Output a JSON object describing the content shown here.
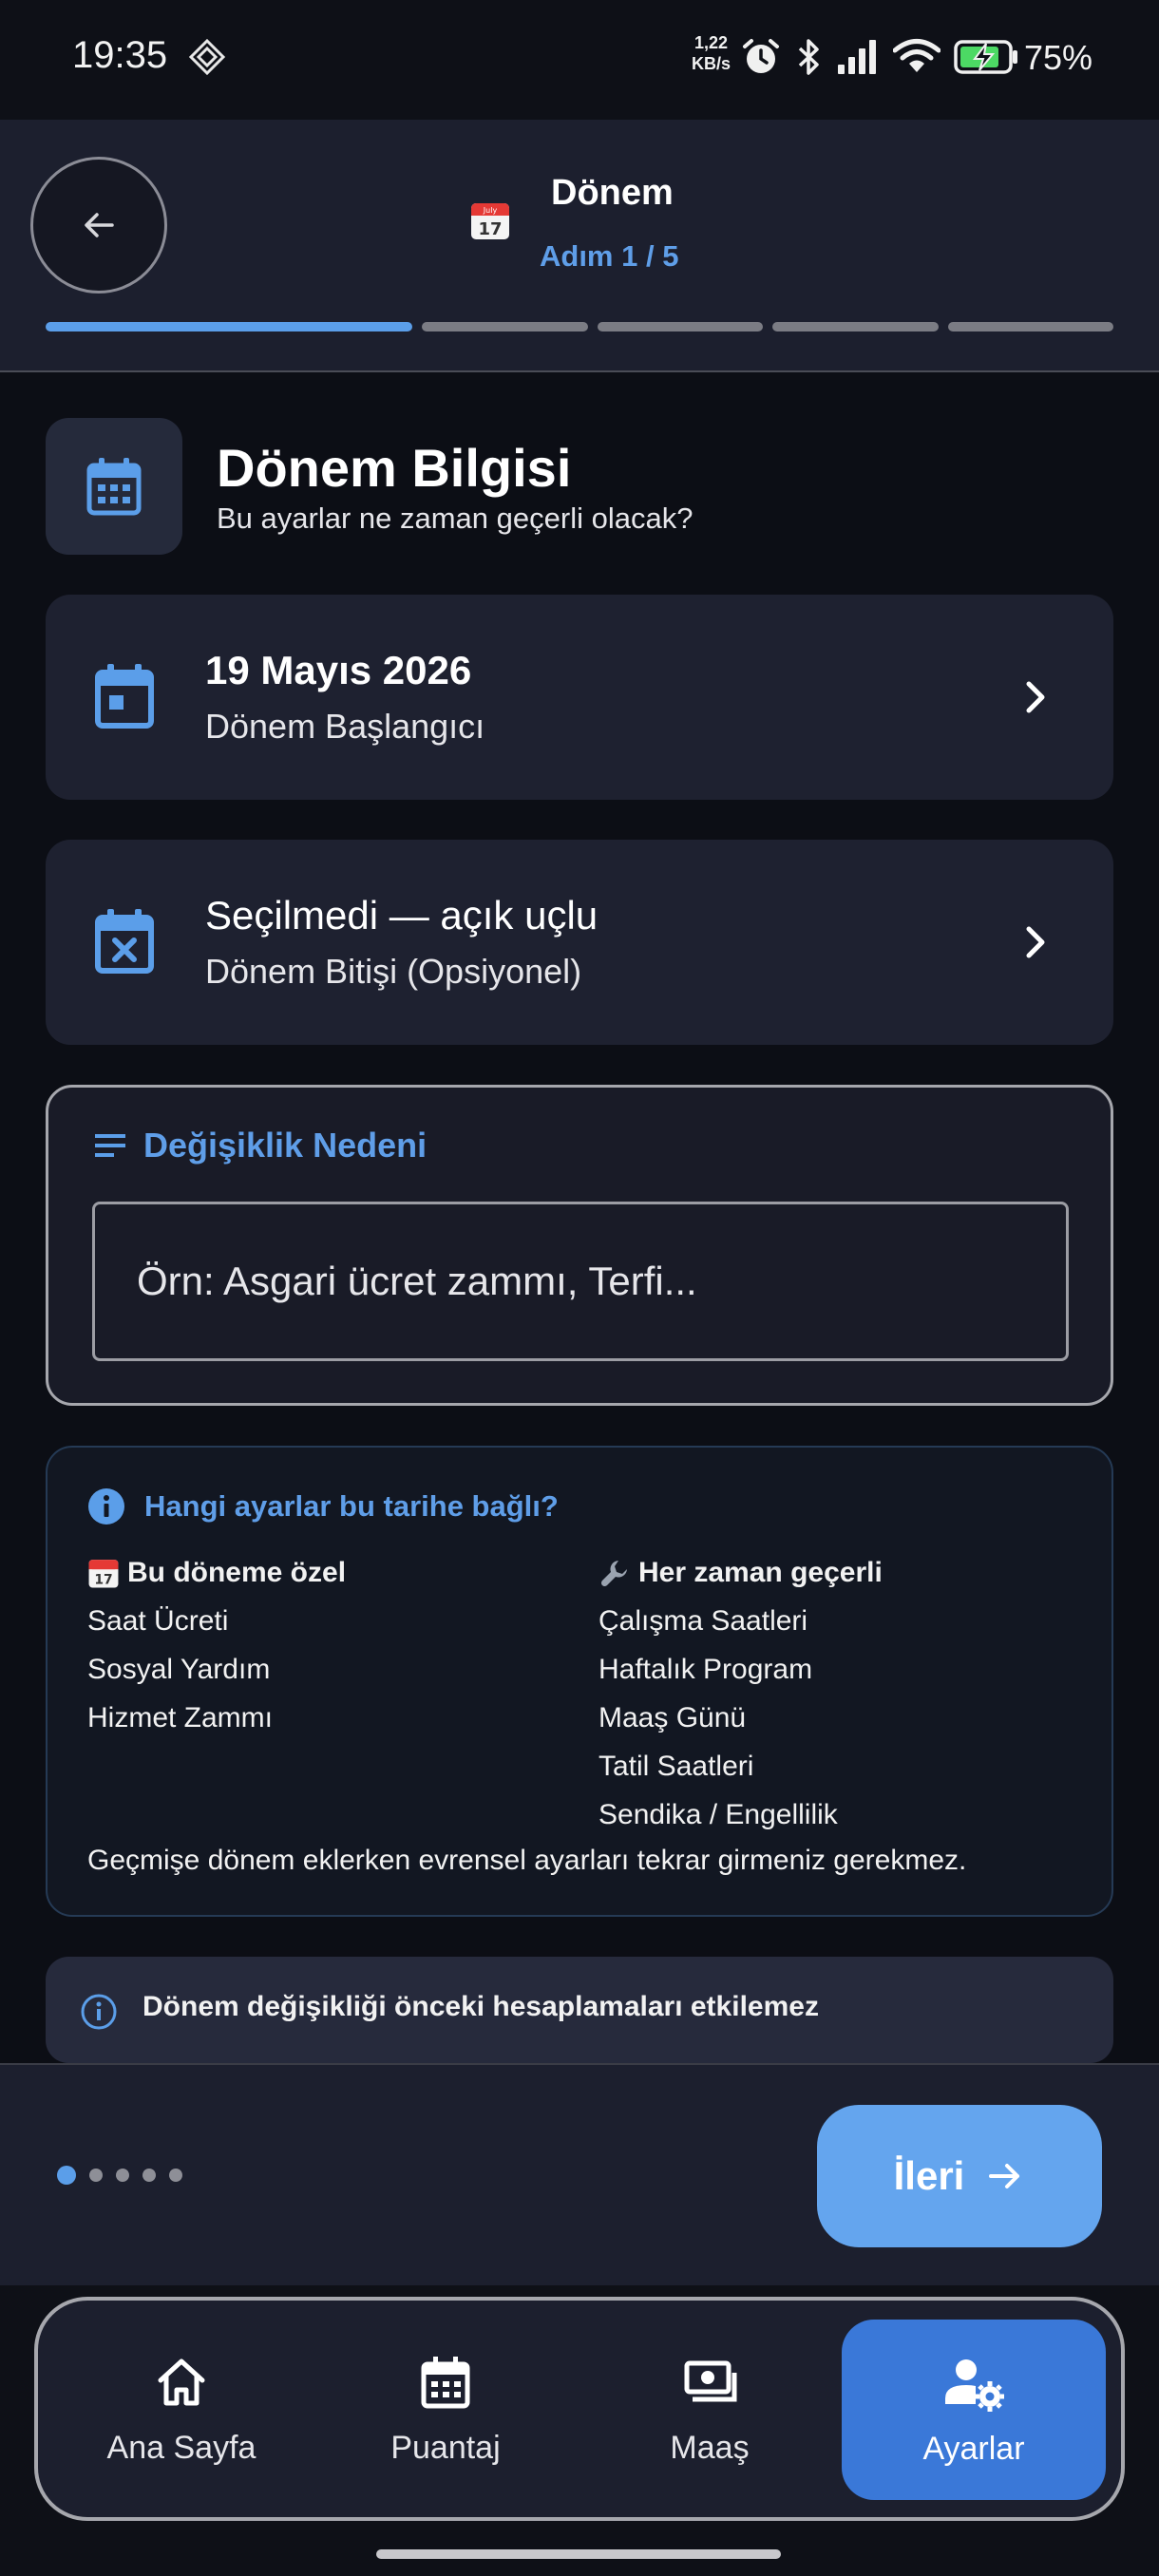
{
  "status_bar": {
    "time": "19:35",
    "net_speed_value": "1,22",
    "net_speed_unit": "KB/s",
    "battery_percent": "75%",
    "icons": [
      "dnd-diamond-icon",
      "alarm-icon",
      "bluetooth-icon",
      "signal-icon",
      "wifi-icon",
      "battery-charging-icon"
    ]
  },
  "header": {
    "title": "Dönem",
    "step": "Adım 1 / 5",
    "total_steps": 5,
    "current_step": 1,
    "back_icon": "arrow-left-icon"
  },
  "section": {
    "title": "Dönem Bilgisi",
    "subtitle": "Bu ayarlar ne zaman geçerli olacak?"
  },
  "start_card": {
    "value": "19 Mayıs 2026",
    "label": "Dönem Başlangıcı"
  },
  "end_card": {
    "value": "Seçilmedi — açık uçlu",
    "label": "Dönem Bitişi (Opsiyonel)"
  },
  "reason": {
    "title": "Değişiklik Nedeni",
    "placeholder": "Örn: Asgari ücret zammı, Terfi..."
  },
  "info": {
    "title": "Hangi ayarlar bu tarihe bağlı?",
    "period_specific": {
      "heading": "Bu döneme özel",
      "items": [
        "Saat Ücreti",
        "Sosyal Yardım",
        "Hizmet Zammı"
      ]
    },
    "always_valid": {
      "heading": "Her zaman geçerli",
      "items": [
        "Çalışma Saatleri",
        "Haftalık Program",
        "Maaş Günü",
        "Tatil Saatleri",
        "Sendika / Engellilik"
      ]
    },
    "footer": "Geçmişe dönem eklerken evrensel ayarları tekrar girmeniz gerekmez."
  },
  "note": {
    "text": "Dönem değişikliği önceki hesaplamaları etkilemez"
  },
  "footer": {
    "next_label": "İleri",
    "page_count": 5,
    "active_page": 1
  },
  "nav": {
    "items": [
      {
        "label": "Ana Sayfa",
        "icon": "home-icon",
        "active": false
      },
      {
        "label": "Puantaj",
        "icon": "calendar-icon",
        "active": false
      },
      {
        "label": "Maaş",
        "icon": "money-icon",
        "active": false
      },
      {
        "label": "Ayarlar",
        "icon": "user-settings-icon",
        "active": true
      }
    ]
  },
  "colors": {
    "accent": "#5b9ee9",
    "background": "#0c0e15",
    "card": "#1e2130",
    "nav_active": "#3a78d8"
  }
}
